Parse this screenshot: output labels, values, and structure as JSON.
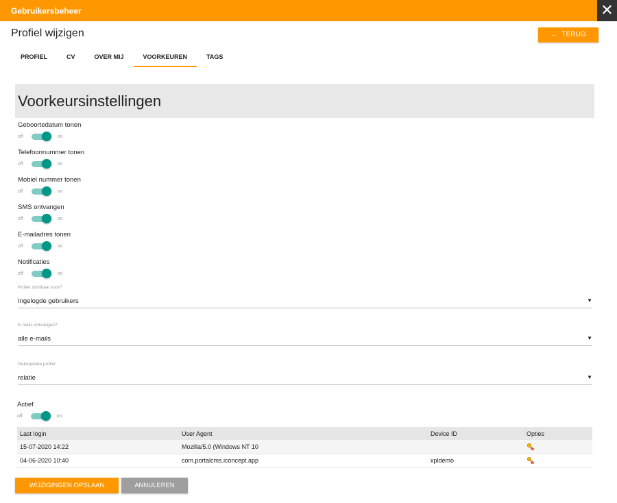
{
  "window": {
    "title": "Gebruikersbeheer",
    "close_glyph": "✕"
  },
  "header": {
    "page_title": "Profiel wijzigen",
    "back_button": {
      "arrow": "←",
      "label": "TERUG"
    }
  },
  "tabs": [
    {
      "label": "PROFIEL",
      "active": false
    },
    {
      "label": "CV",
      "active": false
    },
    {
      "label": "OVER MIJ",
      "active": false
    },
    {
      "label": "VOORKEUREN",
      "active": true
    },
    {
      "label": "TAGS",
      "active": false
    }
  ],
  "section": {
    "title": "Voorkeursinstellingen"
  },
  "toggles": {
    "off_label": "off",
    "on_label": "on",
    "birthdate": {
      "label": "Geboortedatum tonen",
      "value": "on"
    },
    "phone": {
      "label": "Telefoonnummer tonen",
      "value": "on"
    },
    "mobile": {
      "label": "Mobiel nummer tonen",
      "value": "on"
    },
    "sms": {
      "label": "SMS ontvangen",
      "value": "on"
    },
    "email": {
      "label": "E-mailadres tonen",
      "value": "on"
    },
    "notifications": {
      "label": "Notificaties",
      "value": "on"
    },
    "active": {
      "label": "Actief",
      "value": "on"
    }
  },
  "selects": {
    "visibility": {
      "label": "Profiel zichtbaar voor?",
      "value": "Ingelogde gebruikers"
    },
    "emails": {
      "label": "E-mails ontvangen?",
      "value": "alle e-mails"
    },
    "linked_profile": {
      "label": "Gekoppelde profiel",
      "value": "relatie"
    },
    "caret": "▼"
  },
  "logins": {
    "headers": [
      "Last login",
      "User Agent",
      "Device ID",
      "Opties"
    ],
    "rows": [
      {
        "last_login": "15-07-2020 14:22",
        "user_agent": "Mozilla/5.0 (Windows NT 10",
        "device_id": ""
      },
      {
        "last_login": "04-06-2020 10:40",
        "user_agent": "com.portalcms.iconcept.app",
        "device_id": "xpldemo"
      }
    ]
  },
  "footer": {
    "save_label": "WIJZIGINGEN OPSLAAN",
    "cancel_label": "ANNULEREN"
  },
  "colors": {
    "accent": "#ff9800",
    "toggle_on": "#009688",
    "toggle_track": "#80cbc4",
    "cancel": "#9e9e9e",
    "close_bg": "#333333"
  }
}
